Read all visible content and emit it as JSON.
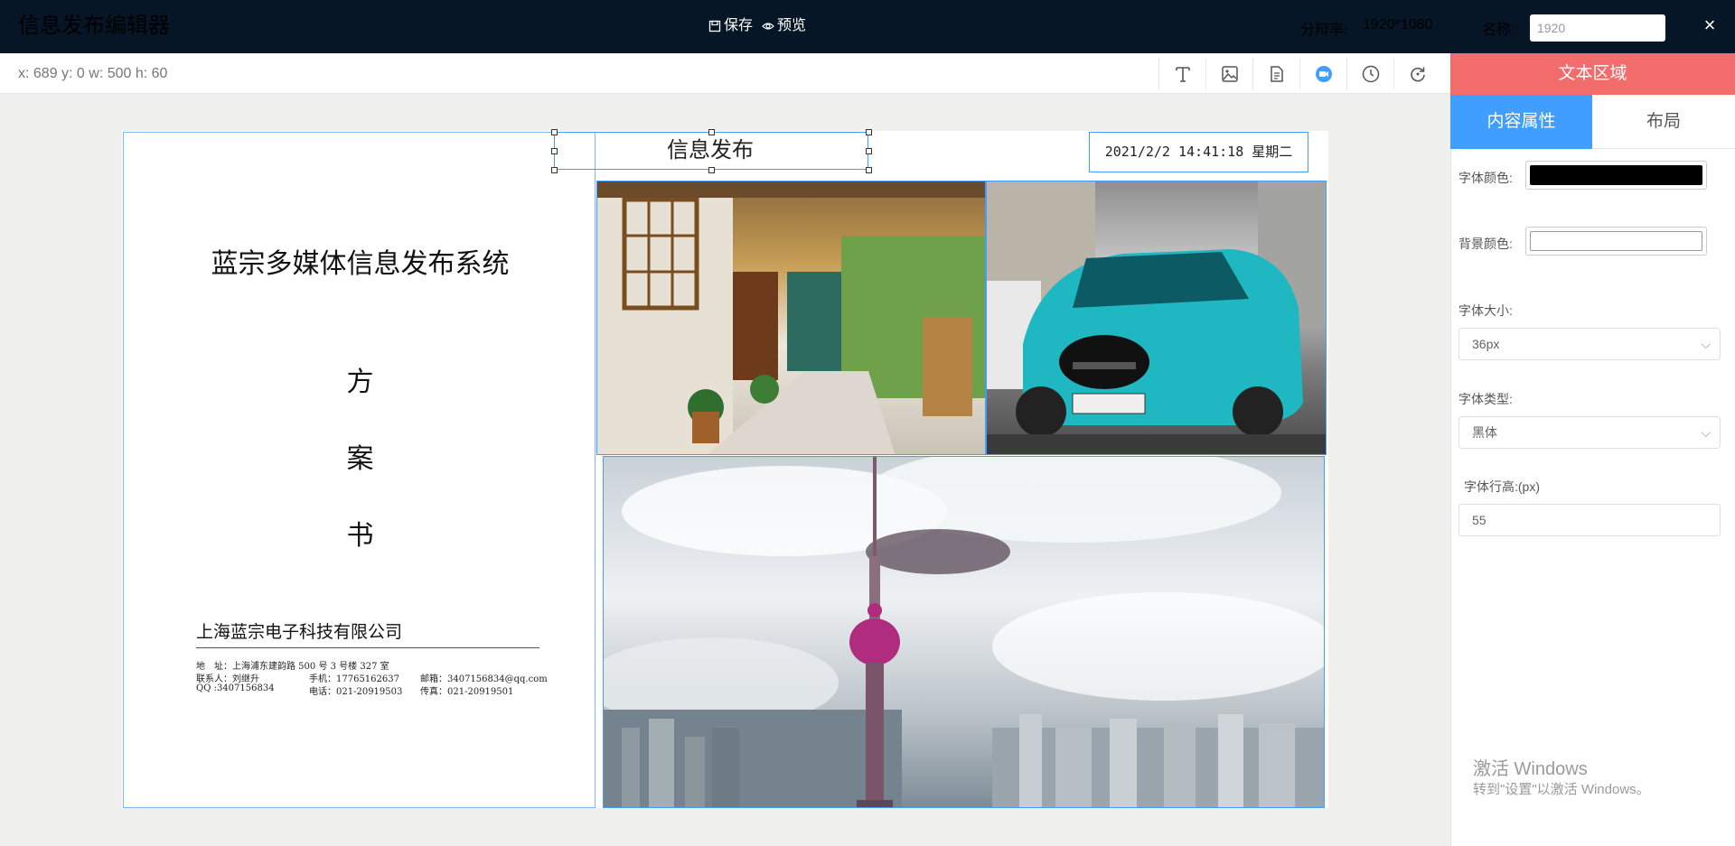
{
  "app": {
    "title": "信息发布编辑器"
  },
  "header": {
    "save_label": "保存",
    "preview_label": "预览",
    "resolution_label": "分辩率:",
    "resolution_value": "1920*1080",
    "name_label": "名称:",
    "name_value": "1920",
    "close_label": "×"
  },
  "toolbar": {
    "coords": "x: 689 y: 0 w: 500 h: 60",
    "tools": [
      {
        "name": "text-tool-button",
        "icon": "text-icon"
      },
      {
        "name": "image-tool-button",
        "icon": "image-icon"
      },
      {
        "name": "document-tool-button",
        "icon": "document-icon"
      },
      {
        "name": "video-tool-button",
        "icon": "video-icon"
      },
      {
        "name": "clock-tool-button",
        "icon": "clock-icon"
      },
      {
        "name": "refresh-tool-button",
        "icon": "refresh-icon"
      }
    ],
    "active_tool_color": "#409eff"
  },
  "canvas": {
    "title_text": "信息发布",
    "datetime": "2021/2/2 14:41:18 星期二",
    "document": {
      "title": "蓝宗多媒体信息发布系统",
      "chars": [
        "方",
        "案",
        "书"
      ],
      "company": "上海蓝宗电子科技有限公司",
      "address_line": "地　址：上海浦东建韵路 500 号 3 号楼 327 室",
      "contact": "联系人：刘继升",
      "mobile": "手机：17765162637",
      "email": "邮箱：3407156834@qq.com",
      "qq": "QQ :3407156834",
      "phone": "电话：021-20919503",
      "fax": "传真：021-20919501"
    },
    "images": [
      {
        "name": "courtyard-image"
      },
      {
        "name": "car-image"
      },
      {
        "name": "tower-image"
      }
    ]
  },
  "sidebar": {
    "region_title": "文本区域",
    "tabs": [
      {
        "label": "内容属性"
      },
      {
        "label": "布局"
      }
    ],
    "font_color_label": "字体颜色:",
    "font_color": "#000000",
    "bg_color_label": "背景颜色:",
    "bg_color": "#ffffff",
    "font_size_label": "字体大小:",
    "font_size": "36px",
    "font_type_label": "字体类型:",
    "font_type": "黑体",
    "line_height_label": "字体行高:(px)",
    "line_height": "55"
  },
  "watermark": {
    "title": "激活 Windows",
    "subtitle": "转到\"设置\"以激活 Windows。"
  }
}
